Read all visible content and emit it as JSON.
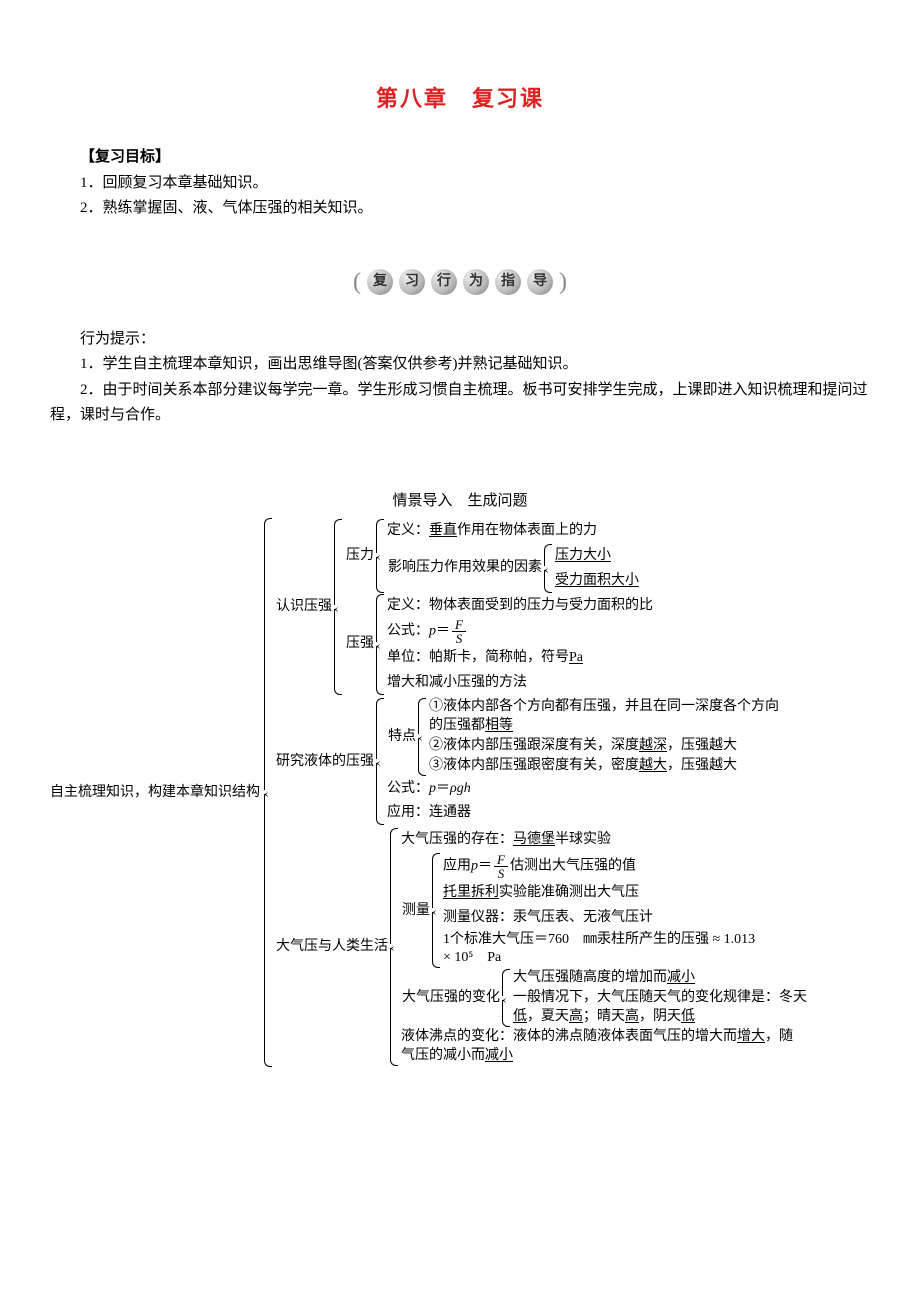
{
  "title": "第八章　复习课",
  "review_goals_label": "【复习目标】",
  "goal1": "1．回顾复习本章基础知识。",
  "goal2": "2．熟练掌握固、液、气体压强的相关知识。",
  "subtitle_beads": [
    "复",
    "习",
    "行",
    "为",
    "指",
    "导"
  ],
  "tips_label": "行为提示：",
  "tip1": "1．学生自主梳理本章知识，画出思维导图(答案仅供参考)并熟记基础知识。",
  "tip2": "2．由于时间关系本部分建议每学完一章。学生形成习惯自主梳理。板书可安排学生完成，上课即进入知识梳理和提问过程，课时与合作。",
  "scene_label": "情景导入　生成问题",
  "root": "自主梳理知识，构建本章知识结构",
  "n1": "认识压强",
  "n1a": "压力",
  "n1a1_pre": "定义：",
  "n1a1_u": "垂直",
  "n1a1_post": "作用在物体表面上的力",
  "n1a2": "影响压力作用效果的因素",
  "n1a2a": "压力大小",
  "n1a2b": "受力面积大小",
  "n1b": "压强",
  "n1b1": "定义：物体表面受到的压力与受力面积的比",
  "n1b2_pre": "公式：",
  "n1b3_pre": "单位：帕斯卡，简称帕，符号",
  "n1b3_u": "Pa",
  "n1b4": "增大和减小压强的方法",
  "n2": "研究液体的压强",
  "n2a": "特点",
  "n2a1_pre": "①液体内部各个方向都有压强，并且在同一深度各个方向的压强都",
  "n2a1_u": "相等",
  "n2a2_pre": "②液体内部压强跟深度有关，深度",
  "n2a2_u": "越深",
  "n2a2_post": "，压强越大",
  "n2a3_pre": "③液体内部压强跟密度有关，密度",
  "n2a3_u": "越大",
  "n2a3_post": "，压强越大",
  "n2b_pre": "公式：",
  "n2c": "应用：连通器",
  "n3": "大气压与人类生活",
  "n3a_pre": "大气压强的存在：",
  "n3a_u": "马德堡",
  "n3a_post": "半球实验",
  "n3b": "测量",
  "n3b1_pre": "应用",
  "n3b1_post": "估测出大气压强的值",
  "n3b2_u": "托里拆利",
  "n3b2_post": "实验能准确测出大气压",
  "n3b3": "测量仪器：汞气压表、无液气压计",
  "n3b4": "1个标准大气压＝760　㎜汞柱所产生的压强 ≈ 1.013 × 10⁵　Pa",
  "n3c": "大气压强的变化",
  "n3c1_pre": "大气压强随高度的增加而",
  "n3c1_u": "减小",
  "n3c2_pre": "一般情况下，大气压随天气的变化规律是：冬天",
  "n3c2_u1": "低",
  "n3c2_mid": "，夏天",
  "n3c2_u2": "高",
  "n3c2_post": "；晴天",
  "n3c2_u3": "高",
  "n3c2_mid2": "，阴天",
  "n3c2_u4": "低",
  "n3d_pre": "液体沸点的变化：液体的沸点随液体表面气压的增大而",
  "n3d_u1": "增大",
  "n3d_mid": "，随气压的减小而",
  "n3d_u2": "减小"
}
